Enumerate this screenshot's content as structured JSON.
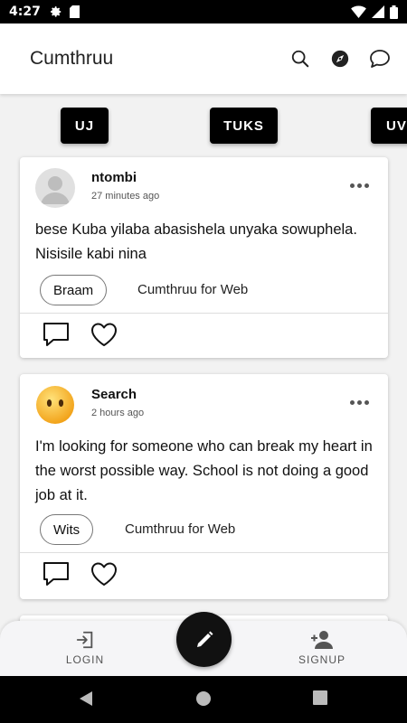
{
  "status_bar": {
    "time": "4:27"
  },
  "app_bar": {
    "title": "Cumthruu",
    "actions": [
      "search-icon",
      "compass-icon",
      "chat-icon"
    ]
  },
  "groups": [
    {
      "label": "UJ"
    },
    {
      "label": "TUKS"
    },
    {
      "label": "UV"
    }
  ],
  "posts": [
    {
      "author": "ntombi",
      "time": "27 minutes ago",
      "body": "bese Kuba yilaba abasishela unyaka sowuphela. Nisisile kabi nina",
      "tag": "Braam",
      "source": "Cumthruu for Web",
      "avatar": "default-person"
    },
    {
      "author": "Search",
      "time": "2 hours ago",
      "body": "I'm looking for someone who can break my heart in the worst possible way. School is not doing a good job at it.",
      "tag": "Wits",
      "source": "Cumthruu for Web",
      "avatar": "emoji-no-mouth"
    }
  ],
  "bottom_nav": {
    "login": "LOGIN",
    "signup": "SIGNUP"
  },
  "colors": {
    "primary": "#000000",
    "card": "#ffffff",
    "background": "#f2f2f2"
  }
}
